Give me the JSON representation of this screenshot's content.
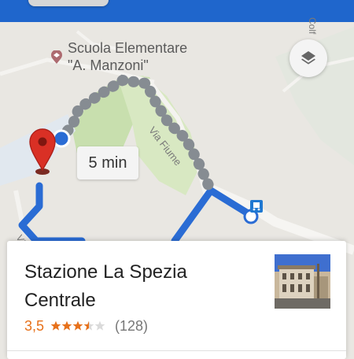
{
  "map": {
    "poi_name": "Scuola Elementare \"A. Manzoni\"",
    "poi_line1": "Scuola Elementare",
    "poi_line2": "\"A. Manzoni\"",
    "street_1": "Via Fiume",
    "street_2": "Via",
    "corner_text": "Colf",
    "route_time": "5 min",
    "icons": {
      "layers": "layers-icon",
      "poi": "school-pin-icon",
      "destination": "red-location-pin-icon",
      "origin": "blue-location-dot-icon",
      "transit": "bus-stop-icon"
    },
    "colors": {
      "route_blue": "#2a6cd4",
      "walking_dots": "#8a8f94",
      "pin_red": "#d93025"
    }
  },
  "place_card": {
    "title": "Stazione La Spezia Centrale",
    "rating": "3,5",
    "stars": 3.5,
    "reviews": "(128)",
    "rating_color": "#e7711b"
  }
}
